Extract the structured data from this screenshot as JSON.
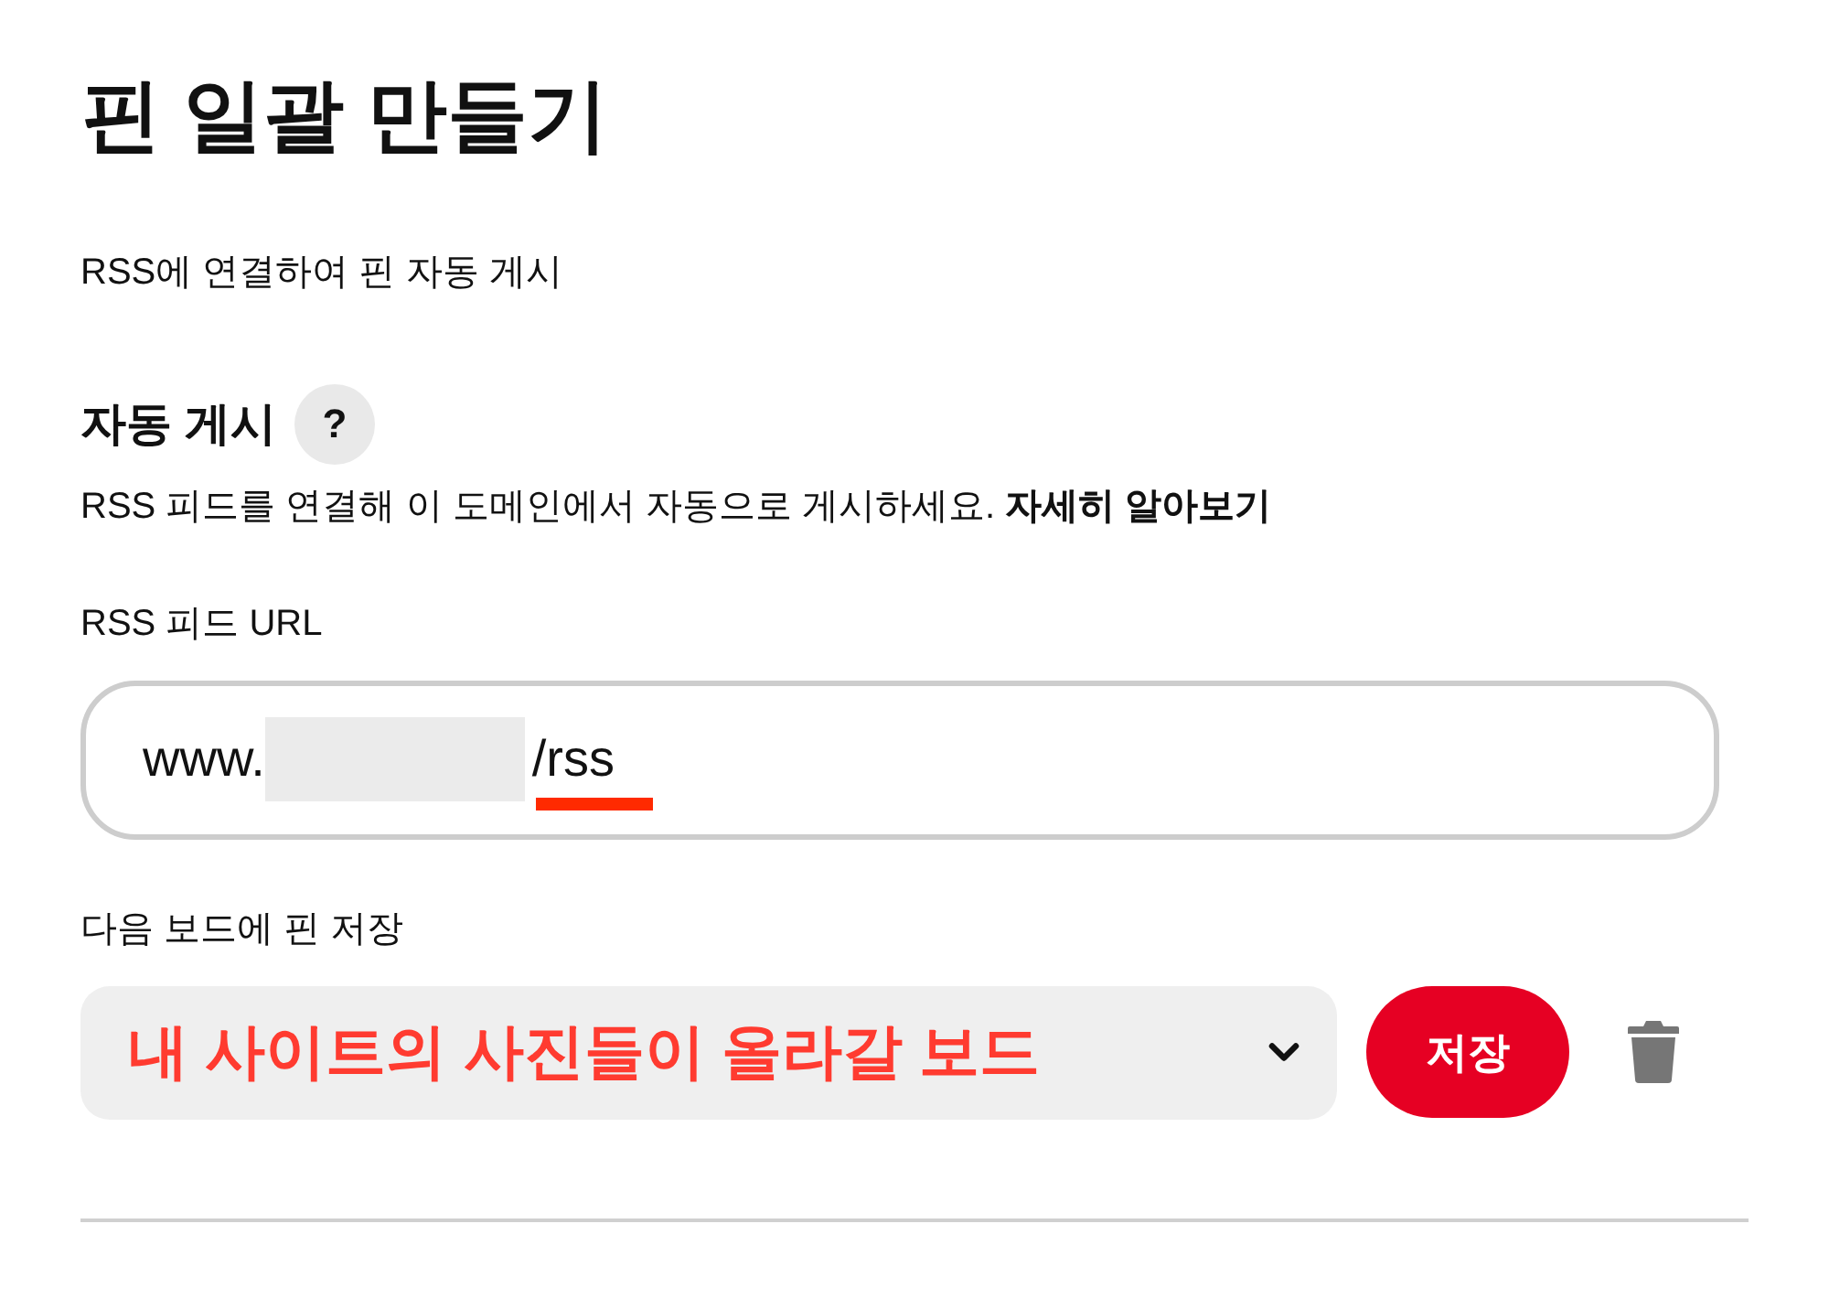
{
  "page": {
    "title": "핀 일괄 만들기",
    "subtitle": "RSS에 연결하여 핀 자동 게시"
  },
  "auto_post": {
    "heading": "자동 게시",
    "help_label": "?",
    "description": "RSS 피드를 연결해 이 도메인에서 자동으로 게시하세요.",
    "learn_more_link": "자세히 알아보기"
  },
  "rss_url": {
    "label": "RSS 피드 URL",
    "value_prefix": "www.",
    "redacted": true,
    "value_suffix": "/rss",
    "suffix_underlined": true
  },
  "board": {
    "label": "다음 보드에 핀 저장",
    "value": "내 사이트의 사진들이 올라갈 보드",
    "save_button": "저장"
  }
}
